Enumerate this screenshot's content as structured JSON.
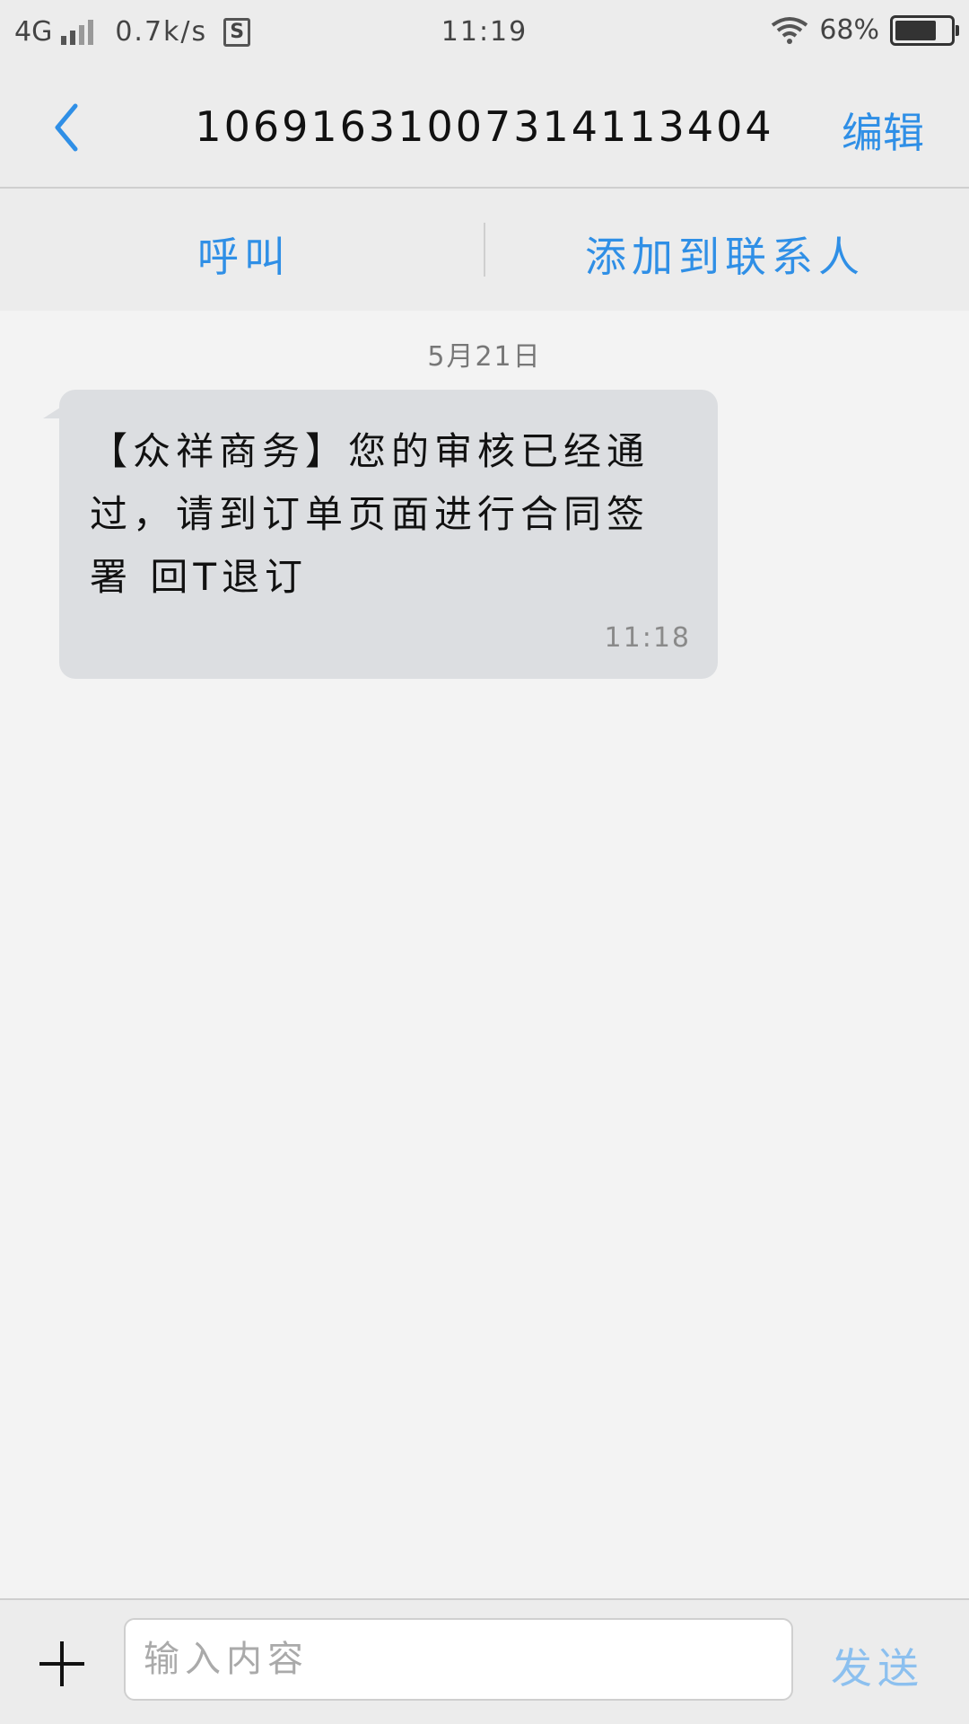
{
  "status_bar": {
    "network": "4G",
    "speed": "0.7k/s",
    "app_icon": "S",
    "time": "11:19",
    "battery": "68%",
    "battery_level": 0.68
  },
  "header": {
    "back_icon": "chevron-left-icon",
    "title": "10691631007314113404",
    "edit_label": "编辑"
  },
  "actions": {
    "call_label": "呼叫",
    "add_contact_label": "添加到联系人"
  },
  "conversation": {
    "date": "5月21日",
    "messages": [
      {
        "text": "【众祥商务】您的审核已经通过，请到订单页面进行合同签署 回T退订",
        "time": "11:18"
      }
    ]
  },
  "input_bar": {
    "plus_icon": "plus-icon",
    "placeholder": "输入内容",
    "send_label": "发送"
  },
  "colors": {
    "accent": "#2f8fe6",
    "send_disabled": "#8cc0ef",
    "bubble": "#dcdee1"
  }
}
